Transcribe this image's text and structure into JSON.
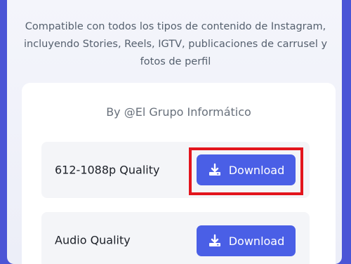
{
  "intro": {
    "text": "Compatible con todos los tipos de contenido de Instagram, incluyendo Stories, Reels, IGTV, publicaciones de carrusel y fotos de perfil"
  },
  "card": {
    "byline": "By @El Grupo Informático",
    "options": [
      {
        "quality_label": "612-1088p Quality",
        "button_label": "Download",
        "highlighted": true
      },
      {
        "quality_label": "Audio Quality",
        "button_label": "Download",
        "highlighted": false
      }
    ]
  },
  "colors": {
    "background": "#4b55d6",
    "button": "#4a5fe6",
    "highlight": "#e3151d"
  },
  "icons": {
    "download": "download-icon"
  }
}
